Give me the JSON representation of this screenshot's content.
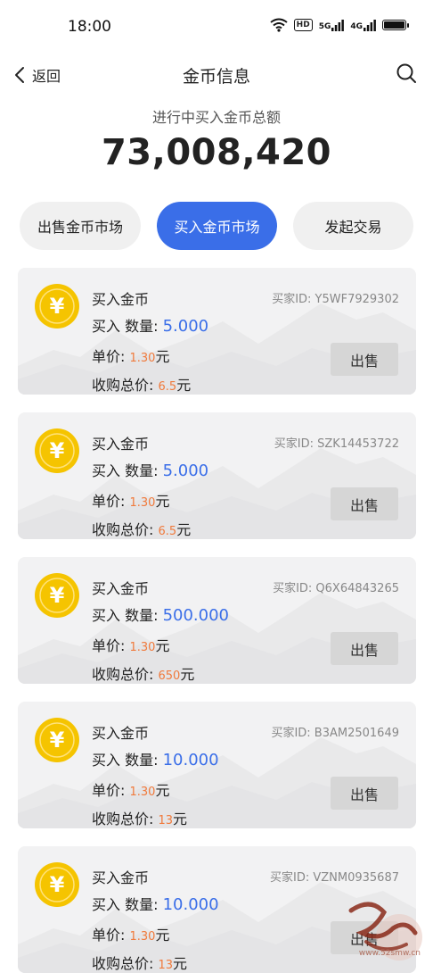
{
  "status_bar": {
    "time": "18:00",
    "hd_label": "HD",
    "net1_label": "5G",
    "net2_label": "4G"
  },
  "nav": {
    "back_label": "返回",
    "title": "金币信息"
  },
  "summary": {
    "label": "进行中买入金币总额",
    "value": "73,008,420"
  },
  "tabs": [
    {
      "label": "出售金币市场",
      "active": false
    },
    {
      "label": "买入金币市场",
      "active": true
    },
    {
      "label": "发起交易",
      "active": false
    }
  ],
  "coin_glyph": "¥",
  "cards": [
    {
      "title": "买入金币",
      "buyer": "买家ID:  Y5WF7929302",
      "qty_label": "买入 数量:",
      "qty": "5.000",
      "price_label": "单价:",
      "price": "1.30",
      "price_unit": "元",
      "total_label": "收购总价:",
      "total": "6.5",
      "total_unit": "元",
      "sell_label": "出售"
    },
    {
      "title": "买入金币",
      "buyer": "买家ID:  SZK14453722",
      "qty_label": "买入 数量:",
      "qty": "5.000",
      "price_label": "单价:",
      "price": "1.30",
      "price_unit": "元",
      "total_label": "收购总价:",
      "total": "6.5",
      "total_unit": "元",
      "sell_label": "出售"
    },
    {
      "title": "买入金币",
      "buyer": "买家ID:  Q6X64843265",
      "qty_label": "买入 数量:",
      "qty": "500.000",
      "price_label": "单价:",
      "price": "1.30",
      "price_unit": "元",
      "total_label": "收购总价:",
      "total": "650",
      "total_unit": "元",
      "sell_label": "出售"
    },
    {
      "title": "买入金币",
      "buyer": "买家ID:  B3AM2501649",
      "qty_label": "买入 数量:",
      "qty": "10.000",
      "price_label": "单价:",
      "price": "1.30",
      "price_unit": "元",
      "total_label": "收购总价:",
      "total": "13",
      "total_unit": "元",
      "sell_label": "出售"
    },
    {
      "title": "买入金币",
      "buyer": "买家ID:  VZNM0935687",
      "qty_label": "买入 数量:",
      "qty": "10.000",
      "price_label": "单价:",
      "price": "1.30",
      "price_unit": "元",
      "total_label": "收购总价:",
      "total": "13",
      "total_unit": "元",
      "sell_label": "出售"
    }
  ],
  "watermark": {
    "text": "吾爱首码",
    "url": "www.52smw.cn"
  },
  "colors": {
    "accent": "#3a6ee8",
    "coin": "#f5c400",
    "price": "#f07a3c",
    "card_bg": "#f2f2f3"
  }
}
